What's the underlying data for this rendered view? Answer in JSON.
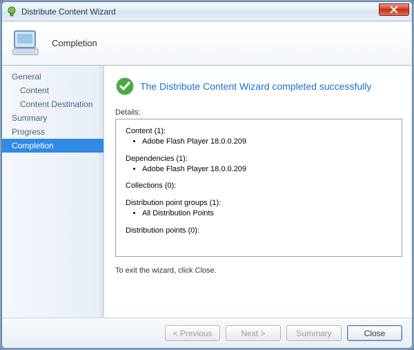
{
  "window": {
    "title": "Distribute Content Wizard"
  },
  "header": {
    "page": "Completion"
  },
  "sidebar": {
    "items": [
      {
        "label": "General",
        "sub": false,
        "selected": false
      },
      {
        "label": "Content",
        "sub": true,
        "selected": false
      },
      {
        "label": "Content Destination",
        "sub": true,
        "selected": false
      },
      {
        "label": "Summary",
        "sub": false,
        "selected": false
      },
      {
        "label": "Progress",
        "sub": false,
        "selected": false
      },
      {
        "label": "Completion",
        "sub": false,
        "selected": true
      }
    ]
  },
  "main": {
    "success_message": "The Distribute Content Wizard completed successfully",
    "details_label": "Details:",
    "details": {
      "Content": {
        "count": 1,
        "items": [
          "Adobe Flash Player 18.0.0.209"
        ]
      },
      "Dependencies": {
        "count": 1,
        "items": [
          "Adobe Flash Player 18.0.0.209"
        ]
      },
      "Collections": {
        "count": 0,
        "items": []
      },
      "Distribution point groups": {
        "count": 1,
        "items": [
          "All Distribution Points"
        ]
      },
      "Distribution points": {
        "count": 0,
        "items": []
      }
    },
    "exit_text": "To exit the wizard, click Close."
  },
  "footer": {
    "previous": "< Previous",
    "next": "Next >",
    "summary": "Summary",
    "close": "Close"
  }
}
